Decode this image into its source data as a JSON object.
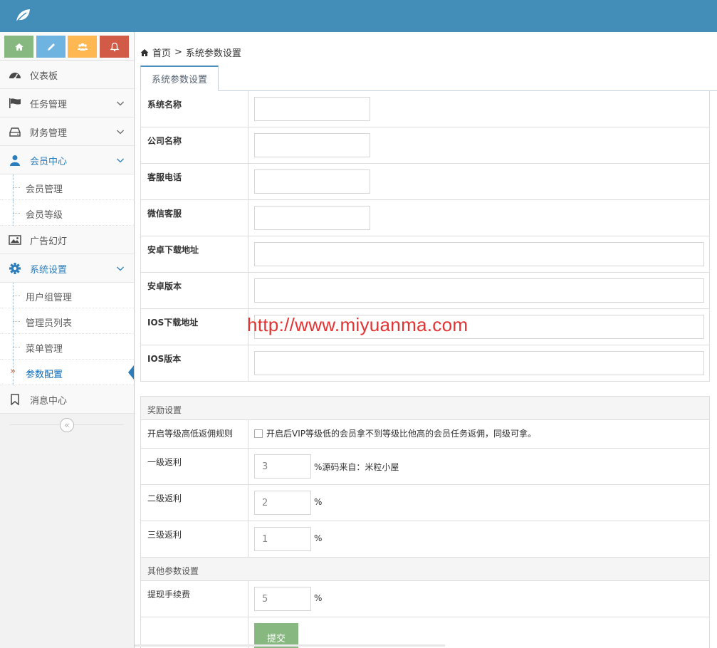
{
  "navbar": {
    "logo_icon": "leaf-icon",
    "background": "#438eb9"
  },
  "shortcuts": [
    {
      "icon": "home-icon",
      "color": "#87b87f"
    },
    {
      "icon": "pencil-icon",
      "color": "#6fb3e0"
    },
    {
      "icon": "users-icon",
      "color": "#ffb752"
    },
    {
      "icon": "bell-icon",
      "color": "#d15b47"
    }
  ],
  "sidebar": {
    "items": [
      {
        "label": "仪表板",
        "icon": "dashboard-icon"
      },
      {
        "label": "任务管理",
        "icon": "flag-icon"
      },
      {
        "label": "财务管理",
        "icon": "hdd-icon"
      },
      {
        "label": "会员中心",
        "icon": "user-icon"
      },
      {
        "label": "广告幻灯",
        "icon": "picture-icon"
      },
      {
        "label": "系统设置",
        "icon": "cog-icon"
      },
      {
        "label": "消息中心",
        "icon": "bookmark-icon"
      }
    ],
    "member_sub": [
      "会员管理",
      "会员等级"
    ],
    "system_sub": [
      "用户组管理",
      "管理员列表",
      "菜单管理",
      "参数配置"
    ],
    "active_mark": "»",
    "collapse_icon": "«"
  },
  "breadcrumb": {
    "home": "首页",
    "separator": ">",
    "current": "系统参数设置"
  },
  "tab": {
    "label": "系统参数设置"
  },
  "basic": {
    "system_name": "系统名称",
    "company_name": "公司名称",
    "service_phone": "客服电话",
    "wechat_service": "微信客服",
    "android_url": "安卓下载地址",
    "android_version": "安卓版本",
    "ios_url": "IOS下载地址",
    "ios_version": "IOS版本"
  },
  "reward": {
    "header": "奖励设置",
    "rule_label": "开启等级高低返佣规则",
    "rule_text": "开启后VIP等级低的会员拿不到等级比他高的会员任务返佣，同级可拿。",
    "level1_label": "一级返利",
    "level1_value": "3",
    "level1_suffix": "%源码来自：米粒小屋",
    "level2_label": "二级返利",
    "level2_value": "2",
    "level2_suffix": "%",
    "level3_label": "三级返利",
    "level3_value": "1",
    "level3_suffix": "%"
  },
  "other": {
    "header": "其他参数设置",
    "fee_label": "提现手续费",
    "fee_value": "5",
    "fee_suffix": "%",
    "submit": "提交"
  },
  "watermark": "http://www.miyuanma.com"
}
